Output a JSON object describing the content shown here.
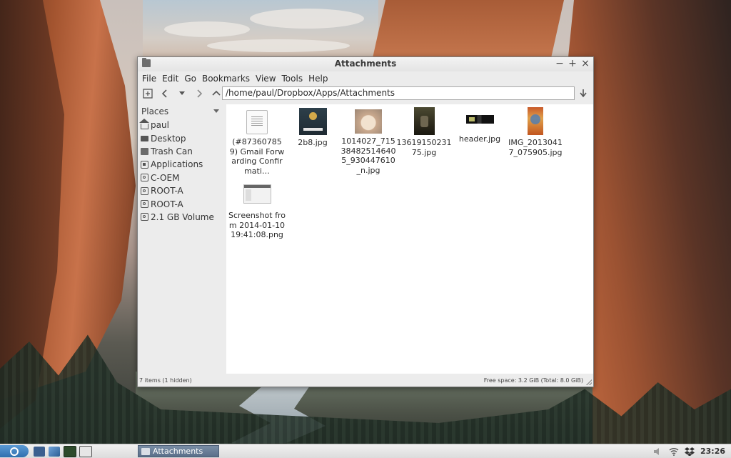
{
  "window": {
    "title": "Attachments",
    "controls": {
      "minimize": "−",
      "maximize": "+",
      "close": "×"
    }
  },
  "menubar": [
    "File",
    "Edit",
    "Go",
    "Bookmarks",
    "View",
    "Tools",
    "Help"
  ],
  "toolbar": {
    "path": "/home/paul/Dropbox/Apps/Attachments",
    "icons": [
      "new-tab-icon",
      "back-arrow-icon",
      "history-dropdown-icon",
      "forward-arrow-icon",
      "up-arrow-icon",
      "go-icon"
    ]
  },
  "sidebar": {
    "header": "Places",
    "items": [
      {
        "label": "paul",
        "icon": "home-icon"
      },
      {
        "label": "Desktop",
        "icon": "desktop-icon"
      },
      {
        "label": "Trash Can",
        "icon": "trash-icon"
      },
      {
        "label": "Applications",
        "icon": "applications-icon"
      },
      {
        "label": "C-OEM",
        "icon": "drive-icon"
      },
      {
        "label": "ROOT-A",
        "icon": "drive-icon"
      },
      {
        "label": "ROOT-A",
        "icon": "drive-icon"
      },
      {
        "label": "2.1 GB Volume",
        "icon": "drive-icon"
      }
    ]
  },
  "files": [
    {
      "name": "(#873607859) Gmail Forwarding Confirmati…",
      "type": "document"
    },
    {
      "name": "2b8.jpg",
      "type": "image"
    },
    {
      "name": "1014027_715384825146405_930447610_n.jpg",
      "type": "image"
    },
    {
      "name": "1361915023175.jpg",
      "type": "image"
    },
    {
      "name": "header.jpg",
      "type": "image"
    },
    {
      "name": "IMG_20130417_075905.jpg",
      "type": "image"
    },
    {
      "name": "Screenshot from 2014-01-10 19:41:08.png",
      "type": "image"
    }
  ],
  "statusbar": {
    "items": "7 items (1 hidden)",
    "free_space": "Free space: 3.2 GiB (Total: 8.0 GiB)"
  },
  "taskbar": {
    "task_label": "Attachments",
    "clock": "23:26",
    "tray_icons": [
      "volume-icon",
      "wifi-icon",
      "dropbox-icon"
    ]
  }
}
